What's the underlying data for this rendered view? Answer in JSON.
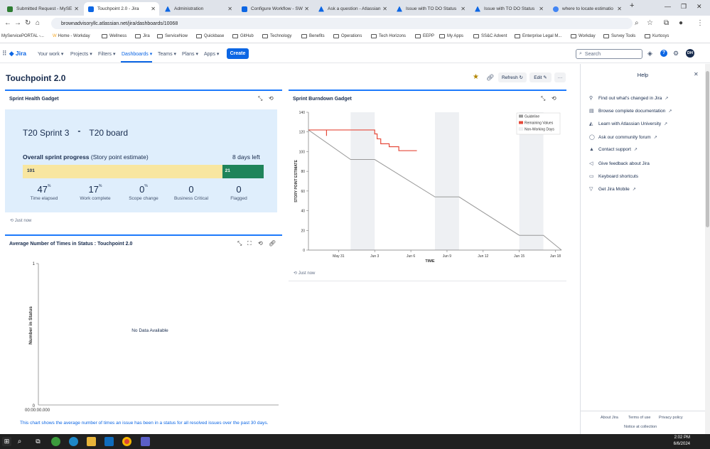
{
  "browser": {
    "tabs": [
      {
        "title": "Submitted Request - MySE",
        "icon": "servicenow-icon",
        "color": "#2e7d32"
      },
      {
        "title": "Touchpoint 2.0 - Jira",
        "icon": "jira-icon",
        "color": "#0c66e4"
      },
      {
        "title": "Administration",
        "icon": "atlassian-icon",
        "color": "#0c66e4"
      },
      {
        "title": "Configure Workflow - SW",
        "icon": "jira-icon",
        "color": "#0c66e4"
      },
      {
        "title": "Ask a question - Atlassian",
        "icon": "atlassian-icon",
        "color": "#0c66e4"
      },
      {
        "title": "Issue with TO DO Status",
        "icon": "atlassian-icon",
        "color": "#0c66e4"
      },
      {
        "title": "Issue with TO DO Status",
        "icon": "atlassian-icon",
        "color": "#0c66e4"
      },
      {
        "title": "where to locate estimatio",
        "icon": "google-icon",
        "color": "#4285f4"
      }
    ],
    "new_tab": "+",
    "url": "brownadvisoryllc.atlassian.net/jira/dashboards/10068",
    "bookmarks": [
      "MyServicePORTAL -...",
      "Home - Workday",
      "Wellness",
      "Jira",
      "ServiceNow",
      "Quickbase",
      "GitHub",
      "Technology",
      "Benefits",
      "Operations",
      "Tech Horizons",
      "EEPP",
      "My Apps",
      "SS&C Advent",
      "Enterprise Legal M...",
      "Workday",
      "Survey Tools",
      "Kurtosys"
    ]
  },
  "jira": {
    "logo": "Jira",
    "nav": [
      "Your work ▾",
      "Projects ▾",
      "Filters ▾",
      "Dashboards ▾",
      "Teams ▾",
      "Plans ▾",
      "Apps ▾"
    ],
    "active_nav": "Dashboards",
    "create": "Create",
    "search_placeholder": "Search",
    "avatar": "DH"
  },
  "page": {
    "title": "Touchpoint 2.0",
    "refresh": "Refresh ↻",
    "edit": "Edit ✎",
    "more": "···"
  },
  "sprint_health": {
    "title": "Sprint Health Gadget",
    "sprint": "T20 Sprint 3",
    "separator": "-",
    "board": "T20 board",
    "progress_label": "Overall sprint progress",
    "progress_sub": "(Story point estimate)",
    "days_left": "8 days left",
    "done_points": 101,
    "remaining_points": 21,
    "stats": [
      {
        "value": "47",
        "unit": "%",
        "label": "Time elapsed"
      },
      {
        "value": "17",
        "unit": "%",
        "label": "Work complete"
      },
      {
        "value": "0",
        "unit": "%",
        "label": "Scope change"
      },
      {
        "value": "0",
        "unit": "",
        "label": "Business Critical"
      },
      {
        "value": "0",
        "unit": "",
        "label": "Flagged"
      }
    ],
    "updated": "Just now"
  },
  "avg_status": {
    "title": "Average Number of Times in Status : Touchpoint 2.0",
    "y_top": "1",
    "y_bottom": "0",
    "x_start": "00:00:00.000",
    "ylabel": "Number in Status",
    "empty": "No Data Available",
    "description": "This chart shows the average number of times an issue has been in a status for all resolved issues over the past 30 days."
  },
  "burndown": {
    "title": "Sprint Burndown Gadget",
    "updated": "Just now"
  },
  "chart_data": {
    "type": "line",
    "title": "",
    "xlabel": "TIME",
    "ylabel": "STORY POINT ESTIMATE",
    "ylim": [
      0,
      140
    ],
    "yticks": [
      0,
      20,
      40,
      60,
      80,
      100,
      120,
      140
    ],
    "xticks": [
      "May 31",
      "Jun 3",
      "Jun 6",
      "Jun 9",
      "Jun 12",
      "Jun 15",
      "Jun 18"
    ],
    "xlim": [
      -2.5,
      18.5
    ],
    "grid": false,
    "legend": "top-right",
    "non_working_spans": [
      [
        1,
        3
      ],
      [
        8,
        10
      ],
      [
        15,
        17
      ]
    ],
    "series": [
      {
        "name": "Guideline",
        "color": "#999999",
        "x": [
          -2.5,
          1,
          3,
          8,
          10,
          15,
          17,
          18.5
        ],
        "y": [
          122,
          92,
          92,
          54,
          54,
          15,
          15,
          0
        ]
      },
      {
        "name": "Remaining Values",
        "color": "#e5493a",
        "x": [
          -2.5,
          -1,
          -1,
          -1,
          3,
          3,
          3.2,
          3.2,
          3.5,
          3.5,
          4.2,
          4.2,
          5,
          5,
          6.5
        ],
        "y": [
          122,
          122,
          116,
          122,
          122,
          118,
          118,
          113,
          113,
          108,
          108,
          105,
          105,
          101,
          101
        ]
      },
      {
        "name": "Non-Working Days",
        "color": "#eef0f3",
        "x": [],
        "y": []
      }
    ]
  },
  "help": {
    "title": "Help",
    "items": [
      {
        "label": "Find out what's changed in Jira",
        "icon": "lightbulb-icon"
      },
      {
        "label": "Browse complete documentation",
        "icon": "book-icon"
      },
      {
        "label": "Learn with Atlassian University",
        "icon": "graduation-icon"
      },
      {
        "label": "Ask our community forum",
        "icon": "chat-icon"
      },
      {
        "label": "Contact support",
        "icon": "atlassian-icon"
      },
      {
        "label": "Give feedback about Jira",
        "icon": "megaphone-icon"
      },
      {
        "label": "Keyboard shortcuts",
        "icon": "keyboard-icon"
      },
      {
        "label": "Get Jira Mobile",
        "icon": "mobile-icon"
      }
    ],
    "footer": [
      "About Jira",
      "Terms of use",
      "Privacy policy",
      "Notice at collection"
    ]
  },
  "taskbar": {
    "time": "2:02 PM",
    "date": "6/6/2024"
  }
}
